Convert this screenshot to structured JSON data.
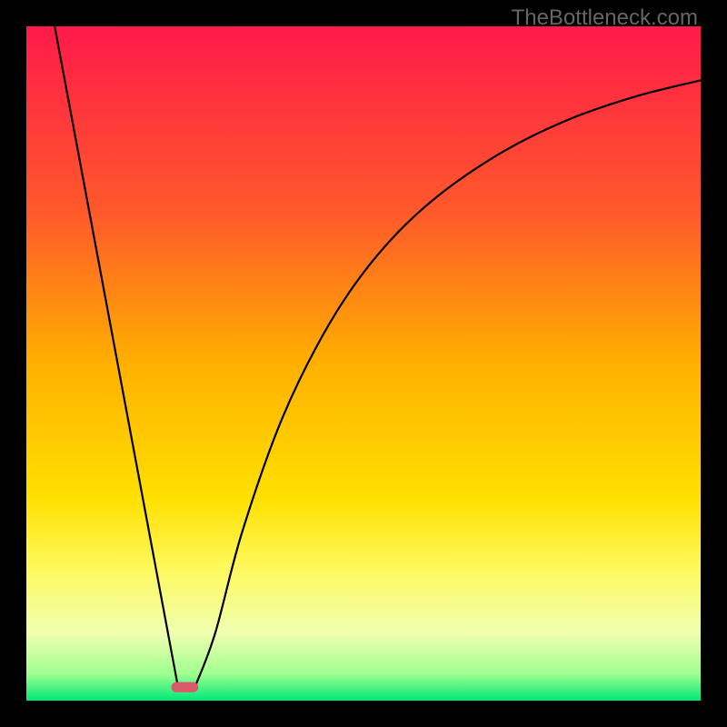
{
  "watermark": "TheBottleneck.com",
  "chart_data": {
    "type": "line",
    "title": "",
    "xlabel": "",
    "ylabel": "",
    "xlim": [
      0,
      100
    ],
    "ylim": [
      0,
      100
    ],
    "gradient_stops": [
      {
        "offset": 0,
        "color": "#ff1a4a"
      },
      {
        "offset": 28,
        "color": "#ff5a2a"
      },
      {
        "offset": 50,
        "color": "#ffb000"
      },
      {
        "offset": 70,
        "color": "#ffe000"
      },
      {
        "offset": 80,
        "color": "#fff85a"
      },
      {
        "offset": 90,
        "color": "#f0ffb0"
      },
      {
        "offset": 96,
        "color": "#a0ff90"
      },
      {
        "offset": 100,
        "color": "#00e878"
      }
    ],
    "series": [
      {
        "name": "left-line",
        "type": "line",
        "points": [
          {
            "x": 4.2,
            "y": 100
          },
          {
            "x": 22.5,
            "y": 2
          }
        ]
      },
      {
        "name": "right-curve",
        "type": "curve",
        "points": [
          {
            "x": 25,
            "y": 2
          },
          {
            "x": 28,
            "y": 10
          },
          {
            "x": 32,
            "y": 25
          },
          {
            "x": 38,
            "y": 42
          },
          {
            "x": 45,
            "y": 56
          },
          {
            "x": 52,
            "y": 66
          },
          {
            "x": 60,
            "y": 74
          },
          {
            "x": 70,
            "y": 81
          },
          {
            "x": 80,
            "y": 86
          },
          {
            "x": 90,
            "y": 89.5
          },
          {
            "x": 100,
            "y": 92
          }
        ]
      }
    ],
    "marker": {
      "x": 23.5,
      "y": 2,
      "width": 4,
      "height": 1.5,
      "color": "#d9596b"
    }
  }
}
